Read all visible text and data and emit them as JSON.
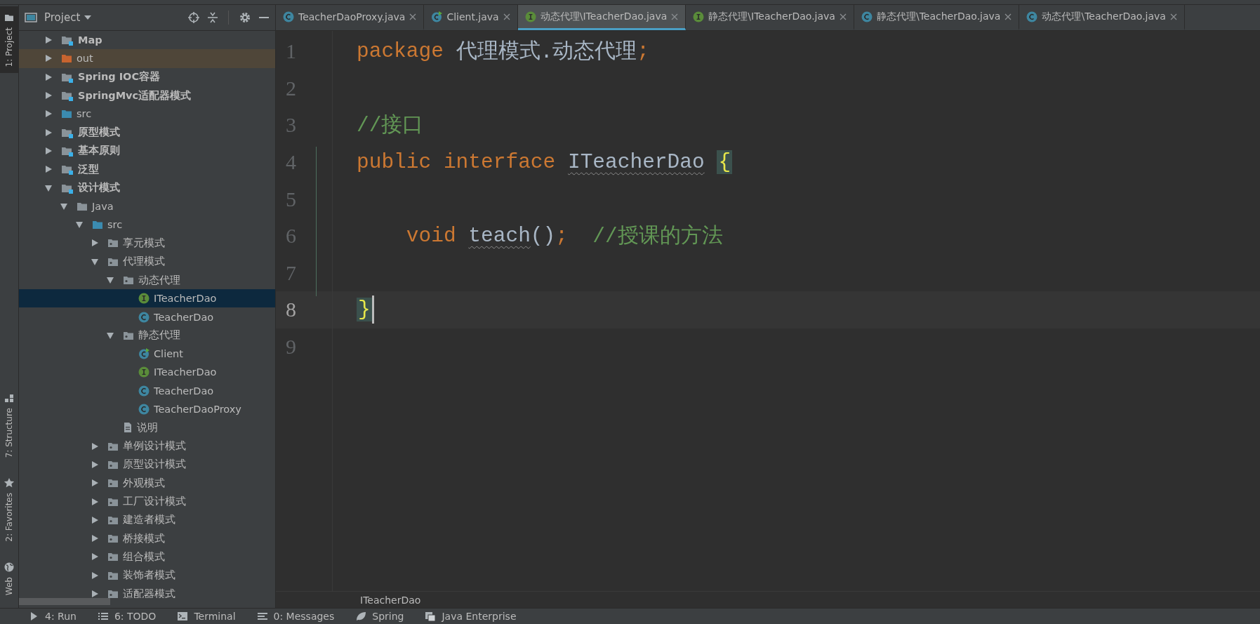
{
  "tool_strip": {
    "top": [
      {
        "label": "1: Project",
        "selected": true,
        "kind": "folder"
      }
    ],
    "bottom": [
      {
        "label": "7: Structure",
        "selected": false,
        "kind": "structure"
      },
      {
        "label": "2: Favorites",
        "selected": false,
        "kind": "star"
      },
      {
        "label": "Web",
        "selected": false,
        "kind": "globe"
      }
    ]
  },
  "project_panel": {
    "title": "Project",
    "tree": [
      {
        "label": "Map",
        "kind": "module",
        "expanded": false,
        "selected": false
      },
      {
        "label": "out",
        "kind": "excluded",
        "expanded": false,
        "selected": false
      },
      {
        "label": "Spring IOC容器",
        "kind": "module",
        "expanded": false,
        "selected": false
      },
      {
        "label": "SpringMvc适配器模式",
        "kind": "module",
        "expanded": false,
        "selected": false
      },
      {
        "label": "src",
        "kind": "source",
        "expanded": false,
        "selected": false
      },
      {
        "label": "原型模式",
        "kind": "module",
        "expanded": false,
        "selected": false
      },
      {
        "label": "基本原则",
        "kind": "module",
        "expanded": false,
        "selected": false
      },
      {
        "label": "泛型",
        "kind": "module",
        "expanded": false,
        "selected": false
      },
      {
        "label": "设计模式",
        "kind": "module",
        "expanded": true,
        "selected": false,
        "children": [
          {
            "label": "Java",
            "kind": "folder",
            "expanded": true,
            "selected": false,
            "children": [
              {
                "label": "src",
                "kind": "source",
                "expanded": true,
                "selected": false,
                "children": [
                  {
                    "label": "享元模式",
                    "kind": "package",
                    "expanded": false,
                    "selected": false
                  },
                  {
                    "label": "代理模式",
                    "kind": "package",
                    "expanded": true,
                    "selected": false,
                    "children": [
                      {
                        "label": "动态代理",
                        "kind": "package",
                        "expanded": true,
                        "selected": false,
                        "children": [
                          {
                            "label": "ITeacherDao",
                            "kind": "interface",
                            "selected": true
                          },
                          {
                            "label": "TeacherDao",
                            "kind": "class",
                            "selected": false
                          }
                        ]
                      },
                      {
                        "label": "静态代理",
                        "kind": "package",
                        "expanded": true,
                        "selected": false,
                        "children": [
                          {
                            "label": "Client",
                            "kind": "runnable",
                            "selected": false
                          },
                          {
                            "label": "ITeacherDao",
                            "kind": "interface",
                            "selected": false
                          },
                          {
                            "label": "TeacherDao",
                            "kind": "class",
                            "selected": false
                          },
                          {
                            "label": "TeacherDaoProxy",
                            "kind": "class",
                            "selected": false
                          }
                        ]
                      },
                      {
                        "label": "说明",
                        "kind": "file",
                        "selected": false
                      }
                    ]
                  },
                  {
                    "label": "单例设计模式",
                    "kind": "package",
                    "expanded": false,
                    "selected": false
                  },
                  {
                    "label": "原型设计模式",
                    "kind": "package",
                    "expanded": false,
                    "selected": false
                  },
                  {
                    "label": "外观模式",
                    "kind": "package",
                    "expanded": false,
                    "selected": false
                  },
                  {
                    "label": "工厂设计模式",
                    "kind": "package",
                    "expanded": false,
                    "selected": false
                  },
                  {
                    "label": "建造者模式",
                    "kind": "package",
                    "expanded": false,
                    "selected": false
                  },
                  {
                    "label": "桥接模式",
                    "kind": "package",
                    "expanded": false,
                    "selected": false
                  },
                  {
                    "label": "组合模式",
                    "kind": "package",
                    "expanded": false,
                    "selected": false
                  },
                  {
                    "label": "装饰者模式",
                    "kind": "package",
                    "expanded": false,
                    "selected": false
                  },
                  {
                    "label": "适配器模式",
                    "kind": "package",
                    "expanded": false,
                    "selected": false
                  }
                ]
              }
            ]
          }
        ]
      }
    ]
  },
  "tabs": [
    {
      "label": "TeacherDaoProxy.java",
      "kind": "class",
      "selected": false
    },
    {
      "label": "Client.java",
      "kind": "runnable",
      "selected": false
    },
    {
      "label": "动态代理\\ITeacherDao.java",
      "kind": "interface",
      "selected": true
    },
    {
      "label": "静态代理\\ITeacherDao.java",
      "kind": "interface",
      "selected": false
    },
    {
      "label": "静态代理\\TeacherDao.java",
      "kind": "class",
      "selected": false
    },
    {
      "label": "动态代理\\TeacherDao.java",
      "kind": "class",
      "selected": false
    }
  ],
  "editor": {
    "lines": [
      {
        "number": "1",
        "current": false,
        "tokens": [
          {
            "text": "package ",
            "kind": "keyword"
          },
          {
            "text": "代理模式.动态代理",
            "kind": "plain"
          },
          {
            "text": ";",
            "kind": "punct"
          }
        ]
      },
      {
        "number": "2",
        "current": false
      },
      {
        "number": "3",
        "current": false,
        "tokens": [
          {
            "text": "//接口",
            "kind": "comment"
          }
        ]
      },
      {
        "number": "4",
        "current": false,
        "tokens": [
          {
            "text": "public interface ",
            "kind": "keyword"
          },
          {
            "text": "ITeacherDao",
            "kind": "warn"
          },
          {
            "text": "{",
            "kind": "brace"
          }
        ]
      },
      {
        "number": "5",
        "current": false
      },
      {
        "number": "6",
        "current": false,
        "tokens": [
          {
            "text": "    void ",
            "kind": "keyword"
          },
          {
            "text": "teach",
            "kind": "warn"
          },
          {
            "text": "()",
            "kind": "plain"
          },
          {
            "text": ";",
            "kind": "punct"
          },
          {
            "text": "  //授课的方法",
            "kind": "comment"
          }
        ]
      },
      {
        "number": "7",
        "current": false
      },
      {
        "number": "8",
        "current": true,
        "tokens": [
          {
            "text": "}",
            "kind": "brace"
          }
        ]
      },
      {
        "number": "9",
        "current": false
      }
    ],
    "breadcrumb": "ITeacherDao"
  },
  "bottom_bar": [
    {
      "label": "4: Run",
      "kind": "run"
    },
    {
      "label": "6: TODO",
      "kind": "list"
    },
    {
      "label": "Terminal",
      "kind": "terminal"
    },
    {
      "label": "0: Messages",
      "kind": "messages"
    },
    {
      "label": "Spring",
      "kind": "leaf"
    },
    {
      "label": "Java Enterprise",
      "kind": "enterprise"
    }
  ]
}
